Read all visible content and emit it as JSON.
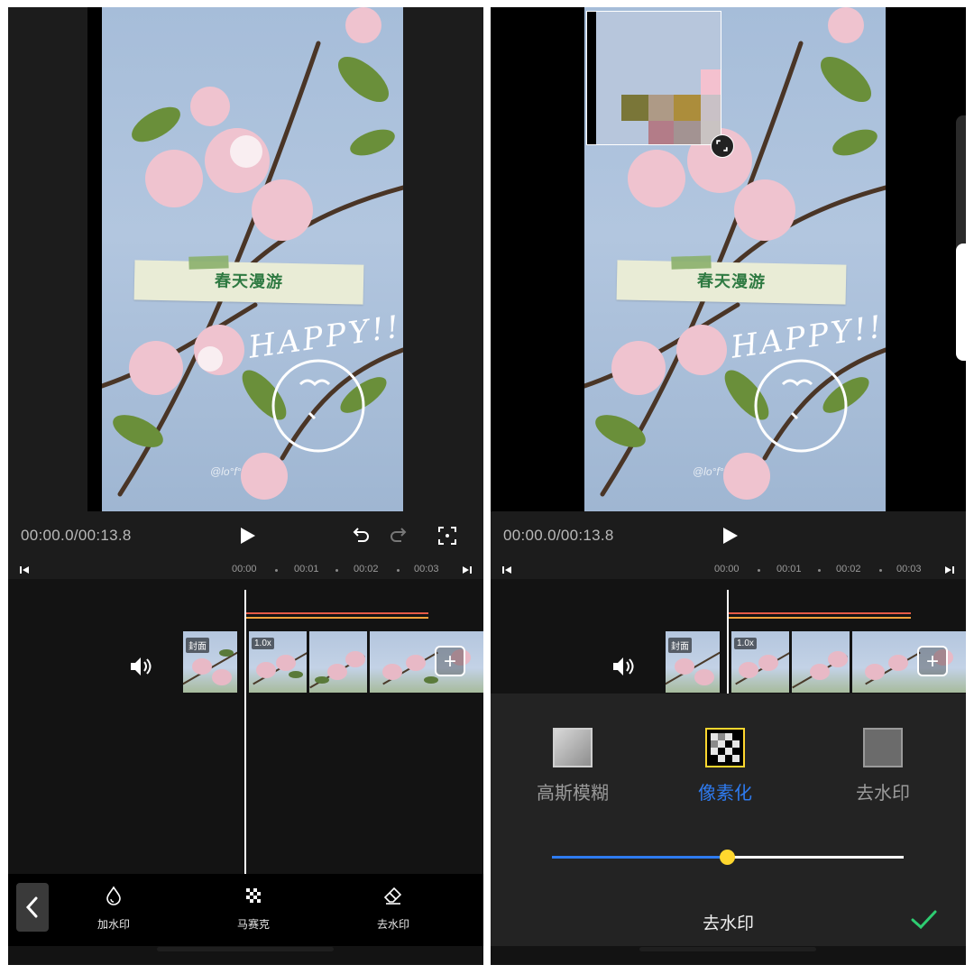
{
  "left_screen": {
    "preview": {
      "banner_text": "春天漫游",
      "sticker_text": "HAPPY!!",
      "signature_text": "@lo°f°"
    },
    "controls": {
      "timecode": "00:00.0/00:13.8",
      "play_icon": "play-icon",
      "undo_icon": "undo-icon",
      "redo_icon": "redo-icon",
      "fullscreen_icon": "fullscreen-icon"
    },
    "ruler": {
      "ticks": [
        "00:00",
        "00:01",
        "00:02",
        "00:03"
      ]
    },
    "timeline": {
      "cover_label": "封面",
      "speed_label": "1.0x",
      "add_label": "+"
    },
    "toolbar": {
      "back_icon": "chevron-left-icon",
      "items": [
        {
          "label": "加水印",
          "icon": "droplet-icon"
        },
        {
          "label": "马赛克",
          "icon": "mosaic-icon"
        },
        {
          "label": "去水印",
          "icon": "eraser-icon"
        }
      ]
    }
  },
  "right_screen": {
    "preview": {
      "banner_text": "春天漫游",
      "sticker_text": "HAPPY!!",
      "signature_text": "@lo°f°",
      "mosaic_colors": [
        "#f4c1cf",
        "#7a7638",
        "#ae9a86",
        "#ac8d3b",
        "#c9c1c6",
        "#b37c88",
        "#a39392",
        "#c9c3c2"
      ]
    },
    "controls": {
      "timecode": "00:00.0/00:13.8"
    },
    "ruler": {
      "ticks": [
        "00:00",
        "00:01",
        "00:02",
        "00:03"
      ]
    },
    "timeline": {
      "cover_label": "封面",
      "speed_label": "1.0x",
      "add_label": "+"
    },
    "options": [
      {
        "label": "高斯模糊",
        "selected": false
      },
      {
        "label": "像素化",
        "selected": true
      },
      {
        "label": "去水印",
        "selected": false
      }
    ],
    "slider": {
      "value": 0.5
    },
    "sheet_title": "去水印",
    "confirm_icon": "checkmark-icon"
  },
  "colors": {
    "accent_blue": "#2e7bf0",
    "selection_yellow": "#ffd72e",
    "confirm_green": "#2ecc71",
    "effect_line_red": "#e45a46",
    "effect_line_orange": "#f2a23c"
  }
}
